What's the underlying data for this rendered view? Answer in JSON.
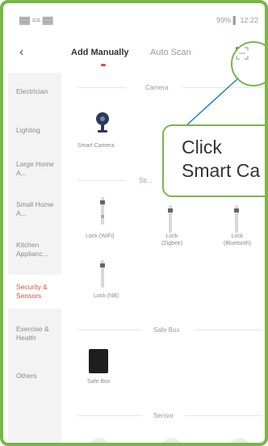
{
  "status": {
    "left": "▓▓ ≡≡ ▓▓",
    "right": "99% ▌ 12:22"
  },
  "header": {
    "back_icon": "chevron-left-icon",
    "tabs": [
      {
        "label": "Add Manually",
        "active": true
      },
      {
        "label": "Auto Scan",
        "active": false
      }
    ],
    "scan_icon": "scan-icon"
  },
  "sidebar": {
    "items": [
      {
        "label": "Electrician"
      },
      {
        "label": "Lighting"
      },
      {
        "label": "Large Home A..."
      },
      {
        "label": "Small Home A..."
      },
      {
        "label": "Kitchen Applianc..."
      },
      {
        "label": "Security & Sensors",
        "active": true
      },
      {
        "label": "Exercise & Health"
      },
      {
        "label": "Others"
      }
    ]
  },
  "sections": {
    "camera": {
      "title": "Camera",
      "devices": [
        {
          "label": "Smart Camera"
        }
      ]
    },
    "lock": {
      "title": "Str...",
      "devices": [
        {
          "label": "Lock (WiFi)"
        },
        {
          "label": "Lock (Zigbee)"
        },
        {
          "label": "Lock (Bluetooth)"
        },
        {
          "label": "Lock (NB)"
        }
      ]
    },
    "safebox": {
      "title": "Safe Box",
      "devices": [
        {
          "label": "Safe Box"
        }
      ]
    },
    "sensor": {
      "title": "Sensor"
    }
  },
  "callout": {
    "line1": "Click",
    "line2": "Smart Ca"
  },
  "colors": {
    "accent": "#e34a3a",
    "annotation": "#7ab648",
    "callout_line": "#1f7fc4"
  }
}
